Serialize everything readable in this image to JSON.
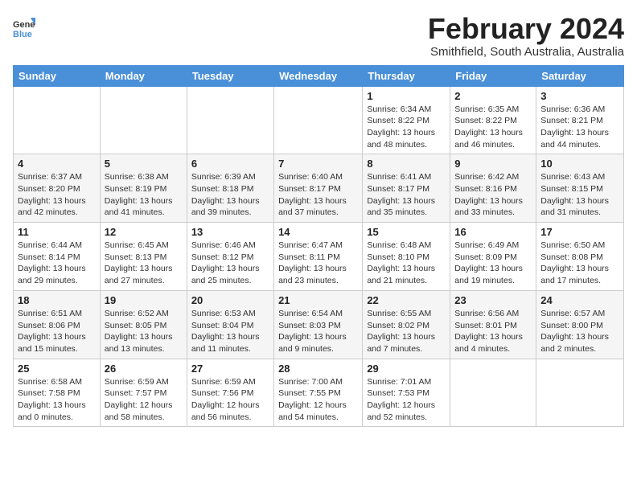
{
  "logo": {
    "line1": "General",
    "line2": "Blue"
  },
  "title": "February 2024",
  "subtitle": "Smithfield, South Australia, Australia",
  "days_of_week": [
    "Sunday",
    "Monday",
    "Tuesday",
    "Wednesday",
    "Thursday",
    "Friday",
    "Saturday"
  ],
  "weeks": [
    [
      {
        "day": "",
        "detail": ""
      },
      {
        "day": "",
        "detail": ""
      },
      {
        "day": "",
        "detail": ""
      },
      {
        "day": "",
        "detail": ""
      },
      {
        "day": "1",
        "detail": "Sunrise: 6:34 AM\nSunset: 8:22 PM\nDaylight: 13 hours\nand 48 minutes."
      },
      {
        "day": "2",
        "detail": "Sunrise: 6:35 AM\nSunset: 8:22 PM\nDaylight: 13 hours\nand 46 minutes."
      },
      {
        "day": "3",
        "detail": "Sunrise: 6:36 AM\nSunset: 8:21 PM\nDaylight: 13 hours\nand 44 minutes."
      }
    ],
    [
      {
        "day": "4",
        "detail": "Sunrise: 6:37 AM\nSunset: 8:20 PM\nDaylight: 13 hours\nand 42 minutes."
      },
      {
        "day": "5",
        "detail": "Sunrise: 6:38 AM\nSunset: 8:19 PM\nDaylight: 13 hours\nand 41 minutes."
      },
      {
        "day": "6",
        "detail": "Sunrise: 6:39 AM\nSunset: 8:18 PM\nDaylight: 13 hours\nand 39 minutes."
      },
      {
        "day": "7",
        "detail": "Sunrise: 6:40 AM\nSunset: 8:17 PM\nDaylight: 13 hours\nand 37 minutes."
      },
      {
        "day": "8",
        "detail": "Sunrise: 6:41 AM\nSunset: 8:17 PM\nDaylight: 13 hours\nand 35 minutes."
      },
      {
        "day": "9",
        "detail": "Sunrise: 6:42 AM\nSunset: 8:16 PM\nDaylight: 13 hours\nand 33 minutes."
      },
      {
        "day": "10",
        "detail": "Sunrise: 6:43 AM\nSunset: 8:15 PM\nDaylight: 13 hours\nand 31 minutes."
      }
    ],
    [
      {
        "day": "11",
        "detail": "Sunrise: 6:44 AM\nSunset: 8:14 PM\nDaylight: 13 hours\nand 29 minutes."
      },
      {
        "day": "12",
        "detail": "Sunrise: 6:45 AM\nSunset: 8:13 PM\nDaylight: 13 hours\nand 27 minutes."
      },
      {
        "day": "13",
        "detail": "Sunrise: 6:46 AM\nSunset: 8:12 PM\nDaylight: 13 hours\nand 25 minutes."
      },
      {
        "day": "14",
        "detail": "Sunrise: 6:47 AM\nSunset: 8:11 PM\nDaylight: 13 hours\nand 23 minutes."
      },
      {
        "day": "15",
        "detail": "Sunrise: 6:48 AM\nSunset: 8:10 PM\nDaylight: 13 hours\nand 21 minutes."
      },
      {
        "day": "16",
        "detail": "Sunrise: 6:49 AM\nSunset: 8:09 PM\nDaylight: 13 hours\nand 19 minutes."
      },
      {
        "day": "17",
        "detail": "Sunrise: 6:50 AM\nSunset: 8:08 PM\nDaylight: 13 hours\nand 17 minutes."
      }
    ],
    [
      {
        "day": "18",
        "detail": "Sunrise: 6:51 AM\nSunset: 8:06 PM\nDaylight: 13 hours\nand 15 minutes."
      },
      {
        "day": "19",
        "detail": "Sunrise: 6:52 AM\nSunset: 8:05 PM\nDaylight: 13 hours\nand 13 minutes."
      },
      {
        "day": "20",
        "detail": "Sunrise: 6:53 AM\nSunset: 8:04 PM\nDaylight: 13 hours\nand 11 minutes."
      },
      {
        "day": "21",
        "detail": "Sunrise: 6:54 AM\nSunset: 8:03 PM\nDaylight: 13 hours\nand 9 minutes."
      },
      {
        "day": "22",
        "detail": "Sunrise: 6:55 AM\nSunset: 8:02 PM\nDaylight: 13 hours\nand 7 minutes."
      },
      {
        "day": "23",
        "detail": "Sunrise: 6:56 AM\nSunset: 8:01 PM\nDaylight: 13 hours\nand 4 minutes."
      },
      {
        "day": "24",
        "detail": "Sunrise: 6:57 AM\nSunset: 8:00 PM\nDaylight: 13 hours\nand 2 minutes."
      }
    ],
    [
      {
        "day": "25",
        "detail": "Sunrise: 6:58 AM\nSunset: 7:58 PM\nDaylight: 13 hours\nand 0 minutes."
      },
      {
        "day": "26",
        "detail": "Sunrise: 6:59 AM\nSunset: 7:57 PM\nDaylight: 12 hours\nand 58 minutes."
      },
      {
        "day": "27",
        "detail": "Sunrise: 6:59 AM\nSunset: 7:56 PM\nDaylight: 12 hours\nand 56 minutes."
      },
      {
        "day": "28",
        "detail": "Sunrise: 7:00 AM\nSunset: 7:55 PM\nDaylight: 12 hours\nand 54 minutes."
      },
      {
        "day": "29",
        "detail": "Sunrise: 7:01 AM\nSunset: 7:53 PM\nDaylight: 12 hours\nand 52 minutes."
      },
      {
        "day": "",
        "detail": ""
      },
      {
        "day": "",
        "detail": ""
      }
    ]
  ]
}
